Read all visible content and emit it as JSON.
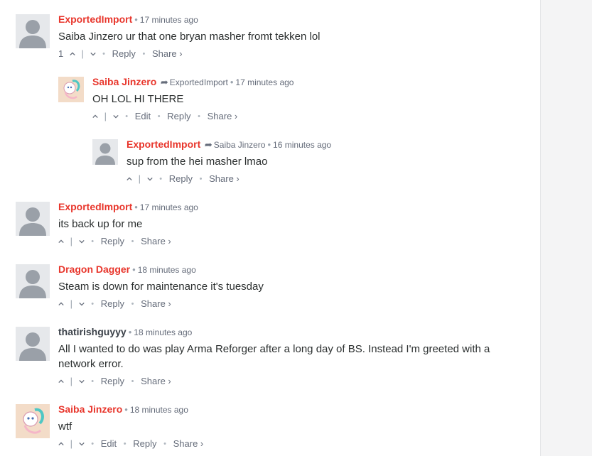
{
  "comments": [
    {
      "author": "ExportedImport",
      "time": "17 minutes ago",
      "text": "Saiba Jinzero ur that one bryan masher fromt tekken lol",
      "votes": "1",
      "reply": "Reply",
      "share": "Share ›"
    },
    {
      "author": "Saiba Jinzero",
      "reply_to": "ExportedImport",
      "time": "17 minutes ago",
      "text": "OH LOL HI THERE",
      "edit": "Edit",
      "reply": "Reply",
      "share": "Share ›"
    },
    {
      "author": "ExportedImport",
      "reply_to": "Saiba Jinzero",
      "time": "16 minutes ago",
      "text": "sup from the hei masher lmao",
      "reply": "Reply",
      "share": "Share ›"
    },
    {
      "author": "ExportedImport",
      "time": "17 minutes ago",
      "text": "its back up for me",
      "reply": "Reply",
      "share": "Share ›"
    },
    {
      "author": "Dragon Dagger",
      "time": "18 minutes ago",
      "text": "Steam is down for maintenance it's tuesday",
      "reply": "Reply",
      "share": "Share ›"
    },
    {
      "author": "thatirishguyyy",
      "time": "18 minutes ago",
      "text": "All I wanted to do was play Arma Reforger after a long day of BS. Instead I'm greeted with a network error.",
      "reply": "Reply",
      "share": "Share ›"
    },
    {
      "author": "Saiba Jinzero",
      "time": "18 minutes ago",
      "text": "wtf",
      "edit": "Edit",
      "reply": "Reply",
      "share": "Share ›"
    }
  ],
  "colors": {
    "author_link": "#e8352b",
    "author_plain": "#3a4048",
    "meta": "#656c7a",
    "sidebar": "#f4f4f5"
  }
}
